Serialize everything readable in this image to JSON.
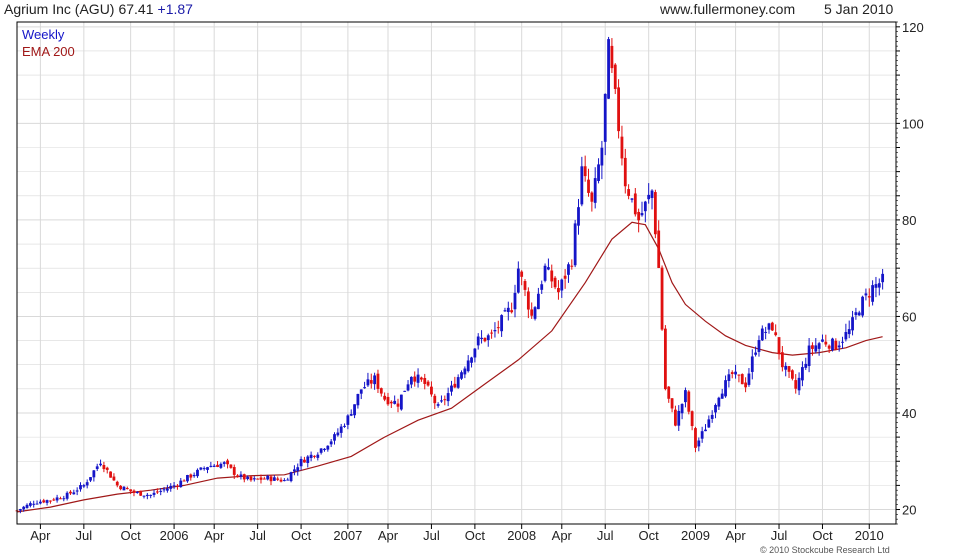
{
  "header": {
    "name": "Agrium Inc (AGU)",
    "price": "67.41",
    "change": "+1.87",
    "site": "www.fullermoney.com",
    "date": "5 Jan 2010"
  },
  "copyright": "© 2010 Stockcube Research Ltd",
  "colors": {
    "up": "#1515c8",
    "down": "#e01010",
    "ema": "#a01818",
    "grid": "#d9d9d9",
    "frame": "#000000"
  },
  "chart_data": {
    "type": "candlestick",
    "legend": [
      "Weekly",
      "EMA 200"
    ],
    "yaxis": {
      "side": "right",
      "range": [
        17,
        121
      ],
      "ticks": [
        20,
        40,
        60,
        80,
        100,
        120
      ]
    },
    "xaxis": {
      "range_weeks": [
        0,
        263
      ],
      "ticks": [
        {
          "label": "Apr",
          "week": 7
        },
        {
          "label": "Jul",
          "week": 20
        },
        {
          "label": "Oct",
          "week": 34
        },
        {
          "label": "2006",
          "week": 47
        },
        {
          "label": "Apr",
          "week": 59
        },
        {
          "label": "Jul",
          "week": 72
        },
        {
          "label": "Oct",
          "week": 85
        },
        {
          "label": "2007",
          "week": 99
        },
        {
          "label": "Apr",
          "week": 111
        },
        {
          "label": "Jul",
          "week": 124
        },
        {
          "label": "Oct",
          "week": 137
        },
        {
          "label": "2008",
          "week": 151
        },
        {
          "label": "Apr",
          "week": 163
        },
        {
          "label": "Jul",
          "week": 176
        },
        {
          "label": "Oct",
          "week": 189
        },
        {
          "label": "2009",
          "week": 203
        },
        {
          "label": "Apr",
          "week": 215
        },
        {
          "label": "Jul",
          "week": 228
        },
        {
          "label": "Oct",
          "week": 241
        },
        {
          "label": "2010",
          "week": 255
        }
      ]
    },
    "price_path": [
      [
        0,
        19.8
      ],
      [
        5,
        21.5
      ],
      [
        10,
        22
      ],
      [
        15,
        23
      ],
      [
        20,
        25
      ],
      [
        25,
        30
      ],
      [
        30,
        25
      ],
      [
        35,
        23.5
      ],
      [
        40,
        23
      ],
      [
        47,
        25
      ],
      [
        52,
        27
      ],
      [
        57,
        29
      ],
      [
        62,
        29.5
      ],
      [
        66,
        27
      ],
      [
        70,
        26
      ],
      [
        75,
        26.5
      ],
      [
        80,
        26
      ],
      [
        85,
        30
      ],
      [
        90,
        32
      ],
      [
        95,
        35
      ],
      [
        99,
        39
      ],
      [
        103,
        45
      ],
      [
        107,
        47
      ],
      [
        110,
        43
      ],
      [
        114,
        42
      ],
      [
        118,
        48
      ],
      [
        122,
        46
      ],
      [
        126,
        41
      ],
      [
        130,
        45
      ],
      [
        134,
        50
      ],
      [
        138,
        55
      ],
      [
        142,
        56
      ],
      [
        148,
        62
      ],
      [
        150,
        70
      ],
      [
        154,
        60
      ],
      [
        158,
        70
      ],
      [
        162,
        65
      ],
      [
        166,
        72
      ],
      [
        169,
        90
      ],
      [
        172,
        83
      ],
      [
        175,
        95
      ],
      [
        177,
        115
      ],
      [
        179,
        105
      ],
      [
        182,
        88
      ],
      [
        186,
        80
      ],
      [
        190,
        86
      ],
      [
        192,
        70
      ],
      [
        194,
        45
      ],
      [
        197,
        38
      ],
      [
        200,
        44
      ],
      [
        203,
        33
      ],
      [
        206,
        37
      ],
      [
        210,
        44
      ],
      [
        214,
        48
      ],
      [
        218,
        46
      ],
      [
        222,
        56
      ],
      [
        226,
        58
      ],
      [
        229,
        50
      ],
      [
        233,
        45
      ],
      [
        237,
        53
      ],
      [
        241,
        55
      ],
      [
        245,
        54
      ],
      [
        249,
        57
      ],
      [
        252,
        62
      ],
      [
        256,
        66
      ],
      [
        259,
        67.4
      ]
    ],
    "ema_200": [
      [
        0,
        19.5
      ],
      [
        10,
        20.5
      ],
      [
        20,
        22
      ],
      [
        30,
        23.2
      ],
      [
        40,
        24
      ],
      [
        50,
        25
      ],
      [
        60,
        26.5
      ],
      [
        70,
        27
      ],
      [
        80,
        27.2
      ],
      [
        90,
        29
      ],
      [
        100,
        31
      ],
      [
        110,
        35
      ],
      [
        120,
        38.5
      ],
      [
        130,
        41
      ],
      [
        140,
        46
      ],
      [
        150,
        51
      ],
      [
        160,
        57
      ],
      [
        170,
        67
      ],
      [
        178,
        76
      ],
      [
        184,
        79.5
      ],
      [
        188,
        79
      ],
      [
        192,
        74
      ],
      [
        196,
        67
      ],
      [
        200,
        62.5
      ],
      [
        206,
        59
      ],
      [
        212,
        56
      ],
      [
        218,
        54
      ],
      [
        226,
        52.5
      ],
      [
        232,
        52
      ],
      [
        240,
        52.5
      ],
      [
        248,
        53.5
      ],
      [
        254,
        55
      ],
      [
        259,
        55.8
      ]
    ],
    "notes": "Weekly OHLC candlesticks: blue = up week, red = down week. Values above are closes traced from the price axis; highs/lows shown as wicks."
  }
}
